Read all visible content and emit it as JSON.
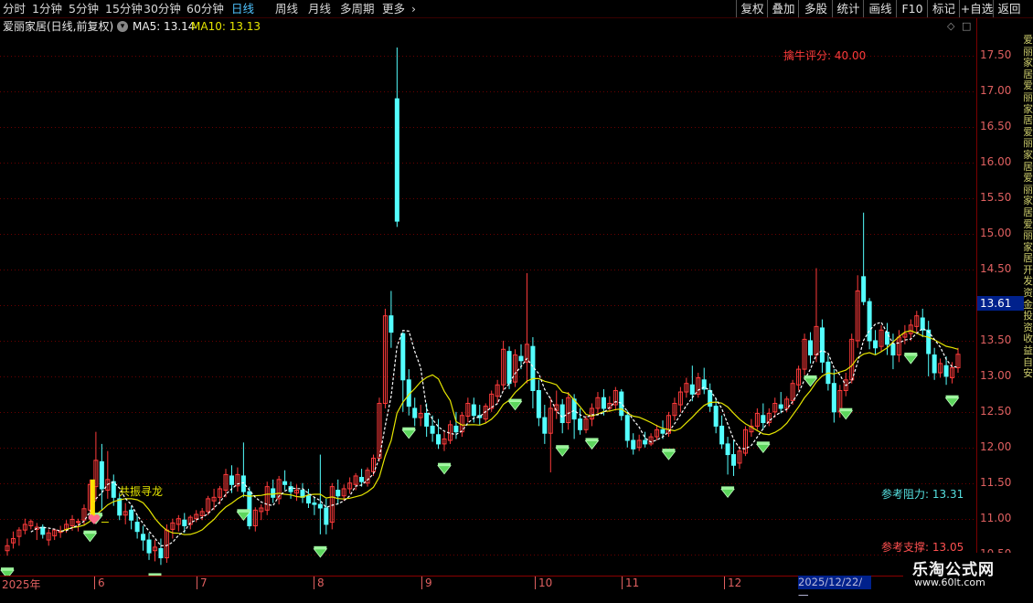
{
  "toolbar": {
    "periods": [
      "分时",
      "1分钟",
      "5分钟",
      "15分钟",
      "30分钟",
      "60分钟",
      "日线",
      "周线",
      "月线",
      "多周期",
      "更多"
    ],
    "more_icon": "chevron-right-icon",
    "active_period": "日线",
    "buttons": [
      "复权",
      "叠加",
      "多股",
      "统计",
      "画线",
      "F10",
      "标记",
      "+自选",
      "返回"
    ]
  },
  "legend": {
    "title": "爱丽家居(日线,前复权)",
    "ma5": "MA5: 13.14",
    "ma10": "MA10: 13.13",
    "dropdown_icon": "chevron-down-circle-icon",
    "ma5_color": "#ffffff",
    "ma10_color": "#e6e600"
  },
  "corner_icons": [
    "diamond-icon",
    "square-icon"
  ],
  "price_axis": {
    "labels": [
      "17.50",
      "17.00",
      "16.50",
      "16.00",
      "15.50",
      "15.00",
      "14.50",
      "14.00",
      "13.50",
      "13.00",
      "12.50",
      "12.00",
      "11.50",
      "11.00",
      "10.50"
    ],
    "current_price": "13.61"
  },
  "annotations": {
    "score": "擒牛评分: 40.00",
    "resistance": "参考阻力: 13.31",
    "support": "参考支撑: 13.05",
    "marker": "共振寻龙",
    "score_color": "#ff3b3b",
    "resistance_color": "#56e0e0",
    "support_color": "#ff5050"
  },
  "date_axis": {
    "labels": [
      "2025年",
      "6",
      "7",
      "8",
      "9",
      "10",
      "11",
      "12"
    ],
    "cursor_date": "2025/12/22/一"
  },
  "right_strip_text": "爱丽家居爱丽家居爱丽家居爱丽家居爱丽家居开发资金投资收益自安",
  "watermark": {
    "name": "乐淘公式网",
    "url": "www.60lt.com"
  },
  "chart_data": {
    "type": "candlestick",
    "ylim": [
      10.2,
      17.8
    ],
    "up_color": "#ff3b3b",
    "down_color": "#54ffff",
    "ma5_color": "#ffffff",
    "ma10_color": "#e6e600",
    "signal_color": "#5dd65d",
    "candles": [
      [
        10.55,
        10.72,
        10.62,
        10.48
      ],
      [
        10.66,
        10.82,
        10.72,
        10.58
      ],
      [
        10.75,
        10.88,
        10.84,
        10.62
      ],
      [
        10.84,
        11.0,
        10.92,
        10.78
      ],
      [
        10.9,
        10.99,
        10.96,
        10.85
      ],
      [
        10.85,
        10.94,
        10.88,
        10.7
      ],
      [
        10.88,
        10.92,
        10.78,
        10.72
      ],
      [
        10.7,
        10.85,
        10.8,
        10.62
      ],
      [
        10.76,
        10.86,
        10.84,
        10.7
      ],
      [
        10.82,
        10.9,
        10.82,
        10.73
      ],
      [
        10.85,
        10.98,
        10.92,
        10.8
      ],
      [
        10.9,
        11.05,
        10.99,
        10.83
      ],
      [
        10.95,
        11.0,
        10.96,
        10.82
      ],
      [
        10.98,
        11.2,
        11.14,
        10.9
      ],
      [
        11.12,
        11.55,
        11.48,
        11.0
      ],
      [
        11.45,
        12.22,
        11.82,
        11.25
      ],
      [
        11.8,
        12.05,
        11.42,
        11.12
      ],
      [
        11.4,
        11.95,
        11.55,
        11.28
      ],
      [
        11.52,
        11.62,
        11.3,
        11.18
      ],
      [
        11.28,
        11.36,
        11.05,
        10.98
      ],
      [
        11.05,
        11.22,
        11.1,
        10.92
      ],
      [
        11.12,
        11.18,
        10.98,
        10.85
      ],
      [
        10.95,
        11.05,
        10.82,
        10.72
      ],
      [
        10.78,
        10.9,
        10.7,
        10.55
      ],
      [
        10.7,
        10.8,
        10.52,
        10.42
      ],
      [
        10.55,
        10.7,
        10.6,
        10.4
      ],
      [
        10.58,
        10.72,
        10.45,
        10.35
      ],
      [
        10.45,
        10.92,
        10.84,
        10.38
      ],
      [
        10.85,
        11.0,
        10.94,
        10.72
      ],
      [
        10.92,
        11.05,
        11.0,
        10.82
      ],
      [
        10.98,
        11.08,
        10.9,
        10.8
      ],
      [
        10.92,
        11.05,
        11.02,
        10.85
      ],
      [
        11.0,
        11.12,
        11.06,
        10.95
      ],
      [
        11.04,
        11.15,
        11.1,
        10.98
      ],
      [
        11.1,
        11.32,
        11.28,
        11.05
      ],
      [
        11.25,
        11.42,
        11.3,
        11.12
      ],
      [
        11.3,
        11.46,
        11.42,
        11.2
      ],
      [
        11.4,
        11.7,
        11.62,
        11.3
      ],
      [
        11.6,
        11.75,
        11.48,
        11.36
      ],
      [
        11.46,
        11.72,
        11.62,
        11.38
      ],
      [
        11.6,
        12.07,
        11.38,
        11.3
      ],
      [
        11.38,
        11.45,
        10.9,
        10.85
      ],
      [
        10.9,
        11.16,
        11.12,
        10.82
      ],
      [
        11.1,
        11.2,
        11.15,
        10.98
      ],
      [
        11.12,
        11.52,
        11.45,
        11.05
      ],
      [
        11.42,
        11.55,
        11.3,
        11.22
      ],
      [
        11.28,
        11.6,
        11.55,
        11.2
      ],
      [
        11.52,
        11.68,
        11.48,
        11.4
      ],
      [
        11.45,
        11.52,
        11.38,
        11.28
      ],
      [
        11.36,
        11.48,
        11.4,
        11.25
      ],
      [
        11.4,
        11.5,
        11.3,
        11.22
      ],
      [
        11.32,
        11.42,
        11.22,
        11.15
      ],
      [
        11.22,
        11.3,
        11.2,
        11.05
      ],
      [
        11.2,
        11.9,
        11.15,
        10.78
      ],
      [
        11.15,
        11.28,
        10.92,
        10.78
      ],
      [
        10.95,
        11.5,
        11.45,
        10.85
      ],
      [
        11.4,
        11.55,
        11.32,
        11.2
      ],
      [
        11.32,
        11.48,
        11.42,
        11.25
      ],
      [
        11.42,
        11.58,
        11.5,
        11.35
      ],
      [
        11.48,
        11.64,
        11.6,
        11.4
      ],
      [
        11.58,
        11.7,
        11.52,
        11.45
      ],
      [
        11.5,
        11.72,
        11.68,
        11.45
      ],
      [
        11.66,
        11.9,
        11.85,
        11.6
      ],
      [
        11.85,
        12.7,
        12.62,
        11.8
      ],
      [
        12.62,
        13.95,
        13.85,
        12.55
      ],
      [
        13.85,
        14.2,
        13.62,
        13.4
      ],
      [
        16.9,
        17.62,
        15.18,
        15.1
      ],
      [
        13.6,
        13.62,
        12.95,
        12.5
      ],
      [
        12.95,
        13.1,
        12.58,
        12.45
      ],
      [
        12.55,
        12.7,
        12.42,
        12.3
      ],
      [
        12.42,
        12.6,
        12.48,
        12.3
      ],
      [
        12.48,
        12.62,
        12.3,
        12.15
      ],
      [
        12.3,
        12.45,
        12.2,
        12.08
      ],
      [
        12.18,
        12.4,
        12.05,
        11.98
      ],
      [
        12.05,
        12.22,
        12.12,
        11.95
      ],
      [
        12.1,
        12.38,
        12.32,
        12.05
      ],
      [
        12.3,
        12.5,
        12.22,
        12.12
      ],
      [
        12.22,
        12.5,
        12.45,
        12.15
      ],
      [
        12.44,
        12.7,
        12.62,
        12.35
      ],
      [
        12.6,
        12.7,
        12.45,
        12.35
      ],
      [
        12.45,
        12.6,
        12.42,
        12.32
      ],
      [
        12.4,
        12.62,
        12.58,
        12.35
      ],
      [
        12.55,
        12.8,
        12.75,
        12.5
      ],
      [
        12.72,
        12.95,
        12.88,
        12.62
      ],
      [
        12.88,
        13.5,
        13.38,
        12.8
      ],
      [
        13.35,
        13.42,
        12.9,
        12.82
      ],
      [
        12.92,
        13.38,
        13.3,
        12.85
      ],
      [
        13.28,
        13.45,
        13.22,
        13.1
      ],
      [
        13.2,
        14.45,
        13.45,
        12.9
      ],
      [
        13.42,
        13.55,
        12.8,
        12.55
      ],
      [
        12.8,
        12.95,
        12.42,
        12.3
      ],
      [
        12.42,
        12.6,
        12.2,
        12.05
      ],
      [
        12.2,
        12.7,
        12.55,
        11.65
      ],
      [
        12.52,
        12.8,
        12.6,
        12.4
      ],
      [
        12.6,
        12.68,
        12.35,
        12.2
      ],
      [
        12.35,
        12.78,
        12.7,
        12.25
      ],
      [
        12.68,
        12.75,
        12.4,
        12.12
      ],
      [
        12.4,
        12.55,
        12.25,
        12.18
      ],
      [
        12.25,
        12.45,
        12.4,
        12.2
      ],
      [
        12.4,
        12.62,
        12.55,
        12.3
      ],
      [
        12.55,
        12.78,
        12.7,
        12.48
      ],
      [
        12.7,
        12.82,
        12.55,
        12.45
      ],
      [
        12.55,
        12.72,
        12.62,
        12.5
      ],
      [
        12.6,
        12.85,
        12.8,
        12.52
      ],
      [
        12.78,
        12.82,
        12.45,
        12.38
      ],
      [
        12.45,
        12.52,
        12.1,
        12.0
      ],
      [
        12.1,
        12.2,
        11.98,
        11.9
      ],
      [
        12.0,
        12.18,
        12.1,
        11.95
      ],
      [
        12.1,
        12.22,
        12.05,
        12.0
      ],
      [
        12.05,
        12.2,
        12.15,
        12.02
      ],
      [
        12.15,
        12.32,
        12.25,
        12.1
      ],
      [
        12.25,
        12.38,
        12.2,
        12.12
      ],
      [
        12.2,
        12.5,
        12.45,
        12.15
      ],
      [
        12.45,
        12.7,
        12.62,
        12.38
      ],
      [
        12.6,
        12.85,
        12.78,
        12.5
      ],
      [
        12.78,
        12.98,
        12.9,
        12.7
      ],
      [
        12.88,
        13.15,
        12.75,
        12.65
      ],
      [
        12.75,
        13.05,
        12.98,
        12.7
      ],
      [
        12.95,
        13.12,
        12.82,
        12.75
      ],
      [
        12.8,
        12.9,
        12.58,
        12.5
      ],
      [
        12.58,
        12.7,
        12.3,
        12.2
      ],
      [
        12.3,
        12.45,
        12.05,
        11.98
      ],
      [
        12.05,
        12.15,
        11.9,
        11.62
      ],
      [
        11.9,
        12.1,
        11.75,
        11.6
      ],
      [
        11.78,
        12.02,
        11.95,
        11.7
      ],
      [
        11.92,
        12.3,
        12.25,
        11.88
      ],
      [
        12.22,
        12.4,
        12.3,
        12.15
      ],
      [
        12.3,
        12.55,
        12.48,
        12.25
      ],
      [
        12.45,
        12.62,
        12.35,
        12.25
      ],
      [
        12.35,
        12.55,
        12.48,
        12.3
      ],
      [
        12.5,
        12.7,
        12.62,
        12.42
      ],
      [
        12.6,
        12.78,
        12.55,
        12.48
      ],
      [
        12.55,
        12.72,
        12.68,
        12.5
      ],
      [
        12.66,
        12.95,
        12.9,
        12.6
      ],
      [
        12.88,
        13.15,
        13.1,
        12.8
      ],
      [
        13.1,
        13.6,
        13.52,
        13.02
      ],
      [
        13.5,
        13.62,
        13.3,
        13.18
      ],
      [
        13.3,
        14.52,
        13.7,
        13.2
      ],
      [
        13.68,
        13.8,
        13.2,
        13.05
      ],
      [
        13.2,
        13.3,
        12.9,
        12.8
      ],
      [
        12.9,
        13.1,
        12.5,
        12.35
      ],
      [
        12.5,
        12.88,
        12.8,
        12.42
      ],
      [
        12.8,
        13.05,
        12.95,
        12.72
      ],
      [
        12.95,
        13.6,
        13.52,
        12.9
      ],
      [
        13.5,
        14.42,
        14.2,
        13.4
      ],
      [
        14.4,
        15.3,
        14.05,
        14.0
      ],
      [
        14.05,
        14.1,
        13.5,
        13.38
      ],
      [
        13.5,
        13.65,
        13.4,
        13.3
      ],
      [
        13.42,
        13.72,
        13.65,
        13.35
      ],
      [
        13.62,
        13.75,
        13.45,
        13.3
      ],
      [
        13.45,
        13.6,
        13.3,
        13.1
      ],
      [
        13.3,
        13.65,
        13.55,
        13.2
      ],
      [
        13.55,
        13.72,
        13.6,
        13.45
      ],
      [
        13.6,
        13.8,
        13.72,
        13.5
      ],
      [
        13.7,
        13.92,
        13.85,
        13.62
      ],
      [
        13.82,
        13.95,
        13.65,
        13.55
      ],
      [
        13.65,
        13.78,
        13.32,
        13.0
      ],
      [
        13.3,
        13.4,
        13.05,
        12.95
      ],
      [
        13.05,
        13.25,
        13.18,
        12.98
      ],
      [
        13.15,
        13.28,
        13.0,
        12.88
      ],
      [
        12.98,
        13.2,
        13.12,
        12.9
      ],
      [
        13.12,
        13.4,
        13.31,
        13.05
      ]
    ],
    "signals": [
      0,
      14,
      15,
      25,
      40,
      53,
      68,
      74,
      86,
      94,
      99,
      112,
      122,
      128,
      136,
      142,
      153,
      160
    ]
  }
}
